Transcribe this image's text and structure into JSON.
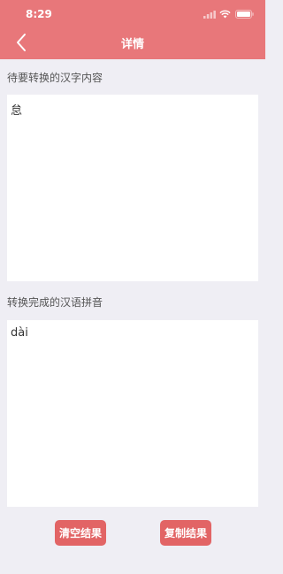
{
  "status_bar": {
    "time": "8:29"
  },
  "nav": {
    "title": "详情",
    "back_icon": "chevron-left-icon"
  },
  "input_section": {
    "label": "待要转换的汉字内容",
    "value": "怠"
  },
  "output_section": {
    "label": "转换完成的汉语拼音",
    "value": "dài"
  },
  "buttons": {
    "clear_label": "清空结果",
    "copy_label": "复制结果"
  },
  "colors": {
    "header": "#e8777a",
    "button": "#e26465",
    "background": "#efeef4"
  }
}
